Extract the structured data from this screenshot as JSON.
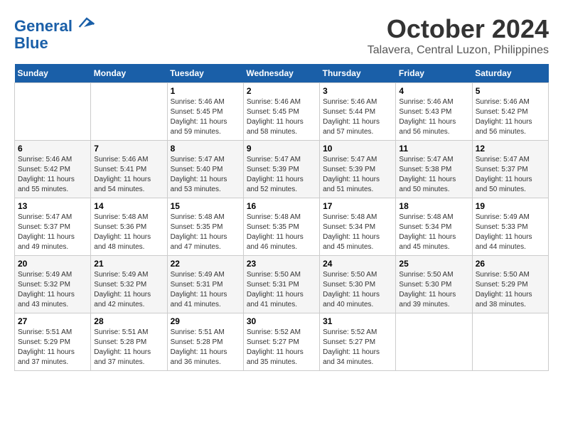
{
  "header": {
    "logo_line1": "General",
    "logo_line2": "Blue",
    "month": "October 2024",
    "location": "Talavera, Central Luzon, Philippines"
  },
  "weekdays": [
    "Sunday",
    "Monday",
    "Tuesday",
    "Wednesday",
    "Thursday",
    "Friday",
    "Saturday"
  ],
  "weeks": [
    [
      {
        "day": "",
        "sunrise": "",
        "sunset": "",
        "daylight": ""
      },
      {
        "day": "",
        "sunrise": "",
        "sunset": "",
        "daylight": ""
      },
      {
        "day": "1",
        "sunrise": "Sunrise: 5:46 AM",
        "sunset": "Sunset: 5:45 PM",
        "daylight": "Daylight: 11 hours and 59 minutes."
      },
      {
        "day": "2",
        "sunrise": "Sunrise: 5:46 AM",
        "sunset": "Sunset: 5:45 PM",
        "daylight": "Daylight: 11 hours and 58 minutes."
      },
      {
        "day": "3",
        "sunrise": "Sunrise: 5:46 AM",
        "sunset": "Sunset: 5:44 PM",
        "daylight": "Daylight: 11 hours and 57 minutes."
      },
      {
        "day": "4",
        "sunrise": "Sunrise: 5:46 AM",
        "sunset": "Sunset: 5:43 PM",
        "daylight": "Daylight: 11 hours and 56 minutes."
      },
      {
        "day": "5",
        "sunrise": "Sunrise: 5:46 AM",
        "sunset": "Sunset: 5:42 PM",
        "daylight": "Daylight: 11 hours and 56 minutes."
      }
    ],
    [
      {
        "day": "6",
        "sunrise": "Sunrise: 5:46 AM",
        "sunset": "Sunset: 5:42 PM",
        "daylight": "Daylight: 11 hours and 55 minutes."
      },
      {
        "day": "7",
        "sunrise": "Sunrise: 5:46 AM",
        "sunset": "Sunset: 5:41 PM",
        "daylight": "Daylight: 11 hours and 54 minutes."
      },
      {
        "day": "8",
        "sunrise": "Sunrise: 5:47 AM",
        "sunset": "Sunset: 5:40 PM",
        "daylight": "Daylight: 11 hours and 53 minutes."
      },
      {
        "day": "9",
        "sunrise": "Sunrise: 5:47 AM",
        "sunset": "Sunset: 5:39 PM",
        "daylight": "Daylight: 11 hours and 52 minutes."
      },
      {
        "day": "10",
        "sunrise": "Sunrise: 5:47 AM",
        "sunset": "Sunset: 5:39 PM",
        "daylight": "Daylight: 11 hours and 51 minutes."
      },
      {
        "day": "11",
        "sunrise": "Sunrise: 5:47 AM",
        "sunset": "Sunset: 5:38 PM",
        "daylight": "Daylight: 11 hours and 50 minutes."
      },
      {
        "day": "12",
        "sunrise": "Sunrise: 5:47 AM",
        "sunset": "Sunset: 5:37 PM",
        "daylight": "Daylight: 11 hours and 50 minutes."
      }
    ],
    [
      {
        "day": "13",
        "sunrise": "Sunrise: 5:47 AM",
        "sunset": "Sunset: 5:37 PM",
        "daylight": "Daylight: 11 hours and 49 minutes."
      },
      {
        "day": "14",
        "sunrise": "Sunrise: 5:48 AM",
        "sunset": "Sunset: 5:36 PM",
        "daylight": "Daylight: 11 hours and 48 minutes."
      },
      {
        "day": "15",
        "sunrise": "Sunrise: 5:48 AM",
        "sunset": "Sunset: 5:35 PM",
        "daylight": "Daylight: 11 hours and 47 minutes."
      },
      {
        "day": "16",
        "sunrise": "Sunrise: 5:48 AM",
        "sunset": "Sunset: 5:35 PM",
        "daylight": "Daylight: 11 hours and 46 minutes."
      },
      {
        "day": "17",
        "sunrise": "Sunrise: 5:48 AM",
        "sunset": "Sunset: 5:34 PM",
        "daylight": "Daylight: 11 hours and 45 minutes."
      },
      {
        "day": "18",
        "sunrise": "Sunrise: 5:48 AM",
        "sunset": "Sunset: 5:34 PM",
        "daylight": "Daylight: 11 hours and 45 minutes."
      },
      {
        "day": "19",
        "sunrise": "Sunrise: 5:49 AM",
        "sunset": "Sunset: 5:33 PM",
        "daylight": "Daylight: 11 hours and 44 minutes."
      }
    ],
    [
      {
        "day": "20",
        "sunrise": "Sunrise: 5:49 AM",
        "sunset": "Sunset: 5:32 PM",
        "daylight": "Daylight: 11 hours and 43 minutes."
      },
      {
        "day": "21",
        "sunrise": "Sunrise: 5:49 AM",
        "sunset": "Sunset: 5:32 PM",
        "daylight": "Daylight: 11 hours and 42 minutes."
      },
      {
        "day": "22",
        "sunrise": "Sunrise: 5:49 AM",
        "sunset": "Sunset: 5:31 PM",
        "daylight": "Daylight: 11 hours and 41 minutes."
      },
      {
        "day": "23",
        "sunrise": "Sunrise: 5:50 AM",
        "sunset": "Sunset: 5:31 PM",
        "daylight": "Daylight: 11 hours and 41 minutes."
      },
      {
        "day": "24",
        "sunrise": "Sunrise: 5:50 AM",
        "sunset": "Sunset: 5:30 PM",
        "daylight": "Daylight: 11 hours and 40 minutes."
      },
      {
        "day": "25",
        "sunrise": "Sunrise: 5:50 AM",
        "sunset": "Sunset: 5:30 PM",
        "daylight": "Daylight: 11 hours and 39 minutes."
      },
      {
        "day": "26",
        "sunrise": "Sunrise: 5:50 AM",
        "sunset": "Sunset: 5:29 PM",
        "daylight": "Daylight: 11 hours and 38 minutes."
      }
    ],
    [
      {
        "day": "27",
        "sunrise": "Sunrise: 5:51 AM",
        "sunset": "Sunset: 5:29 PM",
        "daylight": "Daylight: 11 hours and 37 minutes."
      },
      {
        "day": "28",
        "sunrise": "Sunrise: 5:51 AM",
        "sunset": "Sunset: 5:28 PM",
        "daylight": "Daylight: 11 hours and 37 minutes."
      },
      {
        "day": "29",
        "sunrise": "Sunrise: 5:51 AM",
        "sunset": "Sunset: 5:28 PM",
        "daylight": "Daylight: 11 hours and 36 minutes."
      },
      {
        "day": "30",
        "sunrise": "Sunrise: 5:52 AM",
        "sunset": "Sunset: 5:27 PM",
        "daylight": "Daylight: 11 hours and 35 minutes."
      },
      {
        "day": "31",
        "sunrise": "Sunrise: 5:52 AM",
        "sunset": "Sunset: 5:27 PM",
        "daylight": "Daylight: 11 hours and 34 minutes."
      },
      {
        "day": "",
        "sunrise": "",
        "sunset": "",
        "daylight": ""
      },
      {
        "day": "",
        "sunrise": "",
        "sunset": "",
        "daylight": ""
      }
    ]
  ]
}
